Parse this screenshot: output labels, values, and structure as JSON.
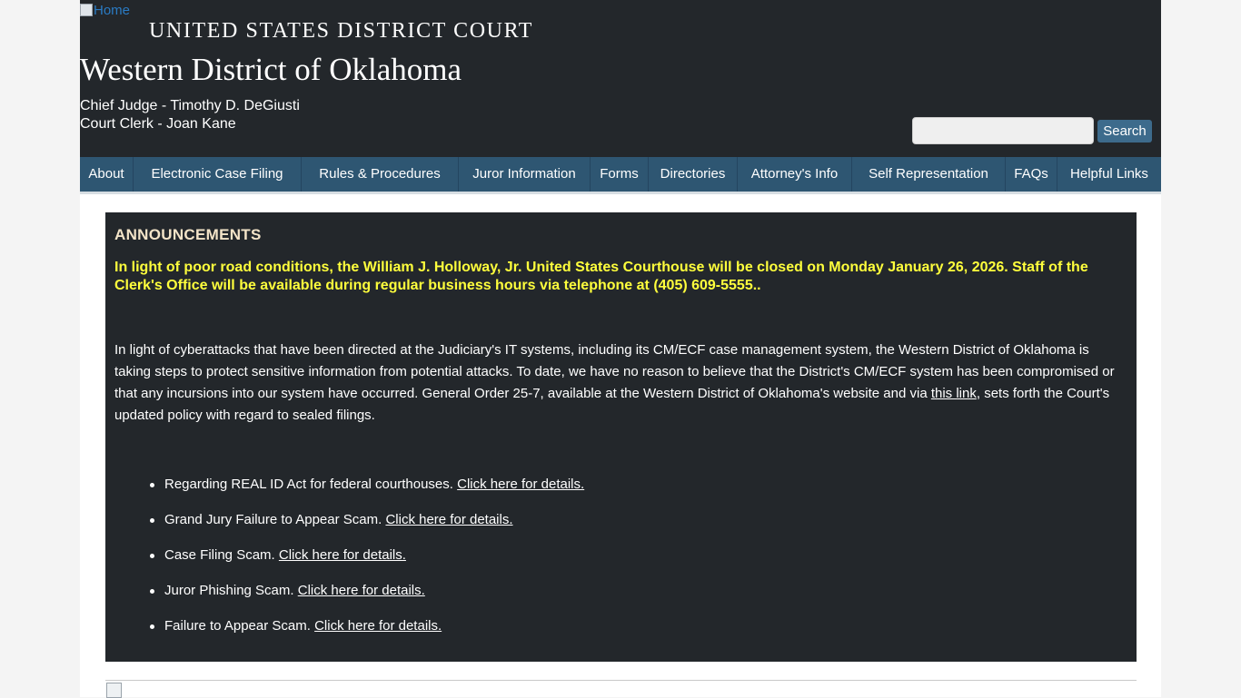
{
  "header": {
    "home_alt": "Home",
    "court_name": "UNITED STATES DISTRICT COURT",
    "district_name": "Western District of Oklahoma",
    "chief_judge": "Chief Judge - Timothy D. DeGiusti",
    "court_clerk": "Court Clerk - Joan Kane"
  },
  "search": {
    "value": "",
    "button_label": "Search"
  },
  "nav": {
    "items": [
      {
        "label": "About"
      },
      {
        "label": "Electronic Case Filing"
      },
      {
        "label": "Rules & Procedures"
      },
      {
        "label": "Juror Information"
      },
      {
        "label": "Forms"
      },
      {
        "label": "Directories"
      },
      {
        "label": "Attorney's Info"
      },
      {
        "label": "Self Representation"
      },
      {
        "label": "FAQs"
      },
      {
        "label": "Helpful Links"
      }
    ]
  },
  "announcements": {
    "title": "ANNOUNCEMENTS",
    "alert": "In light of poor road conditions, the William J. Holloway, Jr. United States Courthouse will be closed on Monday January 26, 2026. Staff of the Clerk's Office will be available during regular business hours via telephone at (405) 609-5555..",
    "cyber_text_before": "In light of cyberattacks that have been directed at the Judiciary's IT systems, including its CM/ECF case management system, the Western District of Oklahoma is taking steps to protect sensitive information from potential attacks. To date, we have no reason to believe that the District's CM/ECF system has been compromised or that any incursions into our system have occurred. General Order 25-7, available at the Western District of Oklahoma's website and via ",
    "cyber_link": "this link",
    "cyber_text_after": ", sets forth the Court's updated policy with regard to sealed filings.",
    "items": [
      {
        "text": "Regarding REAL ID Act for federal courthouses. ",
        "link": "Click here for details."
      },
      {
        "text": "Grand Jury Failure to Appear Scam. ",
        "link": "Click here for details."
      },
      {
        "text": "Case Filing Scam. ",
        "link": "Click here for details."
      },
      {
        "text": "Juror Phishing Scam. ",
        "link": "Click here for details."
      },
      {
        "text": "Failure to Appear Scam. ",
        "link": "Click here for details."
      }
    ]
  }
}
